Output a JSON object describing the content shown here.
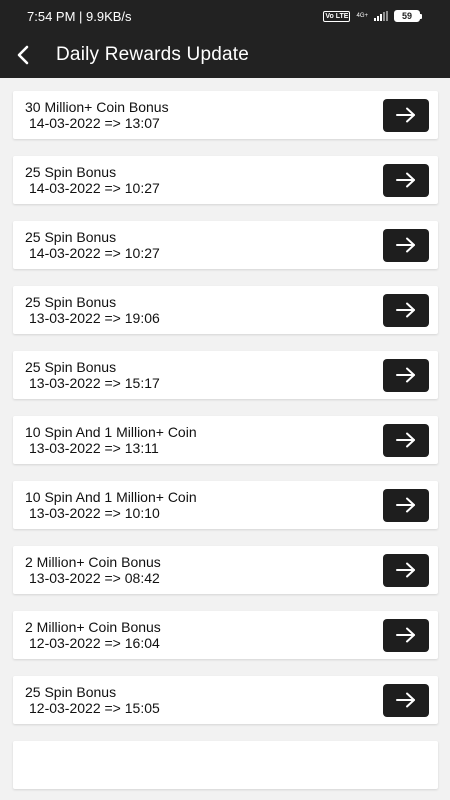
{
  "status_bar": {
    "time_speed": "7:54 PM | 9.9KB/s",
    "volte": "Vo LTE",
    "network": "4G+",
    "battery": "59"
  },
  "app_bar": {
    "title": "Daily Rewards Update",
    "back_icon": "arrow-back-icon"
  },
  "rewards": [
    {
      "title": "30 Million+ Coin Bonus",
      "date": "14-03-2022 => 13:07"
    },
    {
      "title": "25 Spin Bonus",
      "date": "14-03-2022 => 10:27"
    },
    {
      "title": "25 Spin Bonus",
      "date": "14-03-2022 => 10:27"
    },
    {
      "title": "25 Spin Bonus",
      "date": "13-03-2022 => 19:06"
    },
    {
      "title": "25 Spin Bonus",
      "date": "13-03-2022 => 15:17"
    },
    {
      "title": "10 Spin And 1 Million+ Coin",
      "date": "13-03-2022 => 13:11"
    },
    {
      "title": "10 Spin And 1 Million+ Coin",
      "date": "13-03-2022 => 10:10"
    },
    {
      "title": "2 Million+ Coin Bonus",
      "date": "13-03-2022 => 08:42"
    },
    {
      "title": "2 Million+ Coin Bonus",
      "date": "12-03-2022 => 16:04"
    },
    {
      "title": "25 Spin Bonus",
      "date": "12-03-2022 => 15:05"
    }
  ],
  "colors": {
    "bar": "#222222",
    "background": "#f2f2f2",
    "button": "#1e1e1e"
  },
  "item_icon": "arrow-right-icon"
}
